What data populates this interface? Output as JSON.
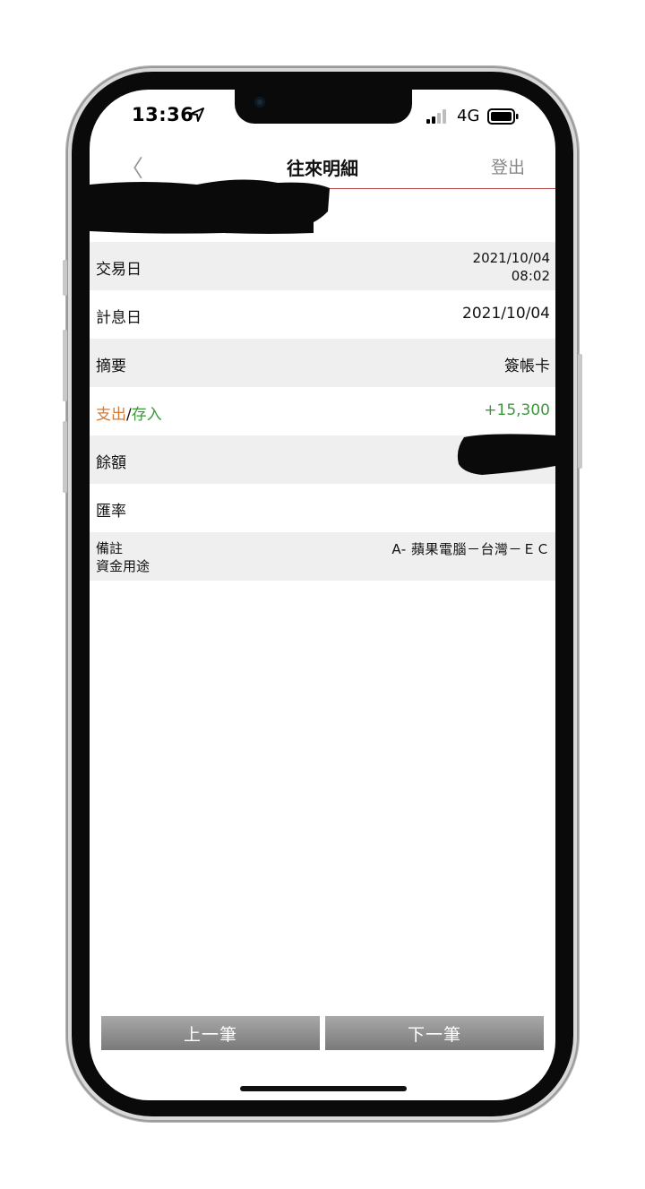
{
  "status_bar": {
    "time": "13:36",
    "location_icon": "location-arrow-icon",
    "network": "4G",
    "signal_icon": "signal-bars-icon",
    "battery_icon": "battery-icon"
  },
  "nav": {
    "back_icon": "chevron-left-icon",
    "back_glyph": "〈",
    "title": "往來明細",
    "logout_label": "登出"
  },
  "details": {
    "trade_date_label": "交易日",
    "trade_date_value": "2021/10/04",
    "trade_time_value": "08:02",
    "value_date_label": "計息日",
    "value_date_value": "2021/10/04",
    "summary_label": "摘要",
    "summary_value": "簽帳卡",
    "withdraw_label": "支出",
    "slash": "/",
    "deposit_label": "存入",
    "amount_value": "+15,300",
    "balance_label": "餘額",
    "exchange_rate_label": "匯率",
    "note_label": "備註",
    "purpose_label": "資金用途",
    "note_value": "A- 蘋果電腦－台灣－ＥＣ"
  },
  "buttons": {
    "prev_label": "上一筆",
    "next_label": "下一筆"
  },
  "colors": {
    "withdraw": "#d07a3a",
    "deposit": "#3a9a3a",
    "nav_line": "#b24a4a",
    "row_shade": "#efefef"
  }
}
